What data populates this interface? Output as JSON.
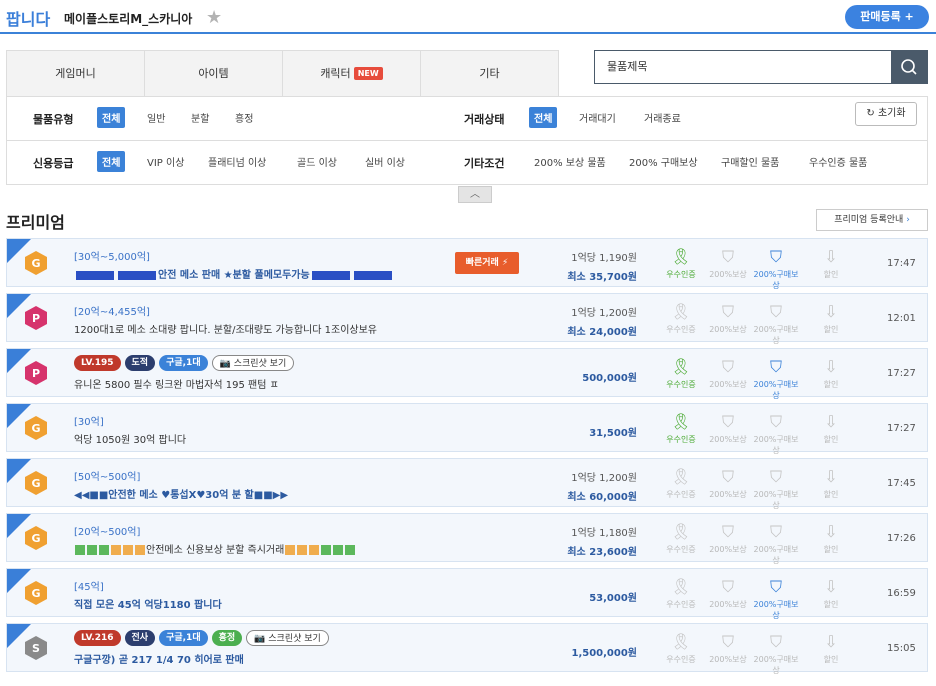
{
  "header": {
    "section": "팝니다",
    "game": "메이플스토리M_스카니아",
    "register_button": "판매등록 +"
  },
  "tabs": [
    {
      "label": "게임머니"
    },
    {
      "label": "아이템"
    },
    {
      "label": "캐릭터",
      "badge": "NEW"
    },
    {
      "label": "기타"
    }
  ],
  "search": {
    "value": "물품제목"
  },
  "filters": {
    "item_type_label": "물품유형",
    "item_types": [
      "전체",
      "일반",
      "분할",
      "흥정"
    ],
    "trade_status_label": "거래상태",
    "trade_statuses": [
      "전체",
      "거래대기",
      "거래종료"
    ],
    "reset_label": "초기화",
    "credit_label": "신용등급",
    "credits": [
      "전체",
      "VIP 이상",
      "플래티넘 이상",
      "골드 이상",
      "실버 이상"
    ],
    "other_label": "기타조건",
    "others": [
      "200% 보상 물품",
      "200% 구매보상",
      "구매할인 물품",
      "우수인증 물품"
    ]
  },
  "premium": {
    "title": "프리미엄",
    "guide_button": "프리미엄 등록안내"
  },
  "icon_labels": {
    "certified": "우수인증",
    "comp200": "200%보상",
    "buy200": "200%구매보상",
    "discount": "할인"
  },
  "listings": [
    {
      "badge_color": "#f0a030",
      "badge_letter": "G",
      "category": "[30억~5,000억]",
      "title": "안전 메소 판매 ★분할 풀메모두가능",
      "fast": "빠른거래",
      "unit": "1억당 1,190원",
      "price": "최소 35,700원",
      "certified": true,
      "buy200": true,
      "time": "17:47"
    },
    {
      "badge_color": "#d6336c",
      "badge_letter": "P",
      "category": "[20억~4,455억]",
      "title": "1200대1로 메소 소대량 팝니다. 분할/조대량도 가능합니다 1조이상보유",
      "unit": "1억당 1,200원",
      "price": "최소 24,000원",
      "certified": false,
      "buy200": false,
      "time": "12:01"
    },
    {
      "badge_color": "#d6336c",
      "badge_letter": "P",
      "tags": [
        "LV.195",
        "도적",
        "구글,1대",
        "스크린샷 보기"
      ],
      "title": "유니온 5800 필수 링크완 마법자석 195 팬텀 ㅍ",
      "price": "500,000원",
      "certified": true,
      "buy200": true,
      "time": "17:27"
    },
    {
      "badge_color": "#f0a030",
      "badge_letter": "G",
      "category": "[30억]",
      "title": "억당 1050원 30억 팝니다",
      "price": "31,500원",
      "certified": true,
      "buy200": false,
      "time": "17:27"
    },
    {
      "badge_color": "#f0a030",
      "badge_letter": "G",
      "category": "[50억~500억]",
      "title": "◀◀■■안전한 메소 ♥통섭X♥30억 분 할■■▶▶",
      "unit": "1억당 1,200원",
      "price": "최소 60,000원",
      "certified": false,
      "buy200": false,
      "time": "17:45"
    },
    {
      "badge_color": "#f0a030",
      "badge_letter": "G",
      "category": "[20억~500억]",
      "title": "안전메소 신용보상 분할 즉시거래",
      "unit": "1억당 1,180원",
      "price": "최소 23,600원",
      "certified": false,
      "buy200": false,
      "time": "17:26"
    },
    {
      "badge_color": "#f0a030",
      "badge_letter": "G",
      "category": "[45억]",
      "title": "직접 모은 45억 억당1180 팝니다",
      "price": "53,000원",
      "certified": false,
      "buy200": true,
      "time": "16:59"
    },
    {
      "badge_color": "#8a8a8a",
      "badge_letter": "S",
      "tags": [
        "LV.216",
        "전사",
        "구글,1대",
        "흥정",
        "스크린샷 보기"
      ],
      "title": "구글구깡) 곧 217 1/4 70 히어로 판매",
      "price": "1,500,000원",
      "certified": false,
      "buy200": false,
      "time": "15:05"
    }
  ]
}
